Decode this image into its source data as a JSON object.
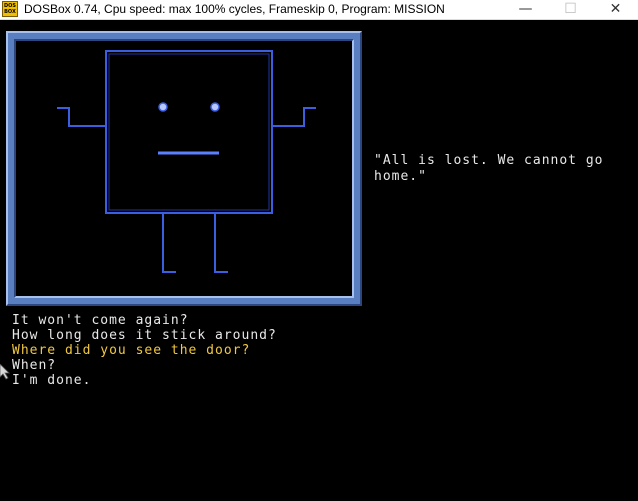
{
  "window": {
    "title": "DOSBox 0.74, Cpu speed: max 100% cycles, Frameskip  0, Program:  MISSION",
    "icon_text": "DOS BOX",
    "icon": "dosbox-icon",
    "minimize": "—",
    "maximize": "☐",
    "close": "✕"
  },
  "scene": {
    "frame_color": "#5a7fc0",
    "line_color": "#3a5fe0",
    "character": "robot-face"
  },
  "quote": "\"All is lost. We cannot go home.\"",
  "dialogue": {
    "options": [
      "It won't come again?",
      "How long does it stick around?",
      "Where did you see the door?",
      "When?",
      "I'm done."
    ],
    "selected_index": 2,
    "text_color": "#e8e8e8",
    "selected_color": "#f0c840"
  }
}
